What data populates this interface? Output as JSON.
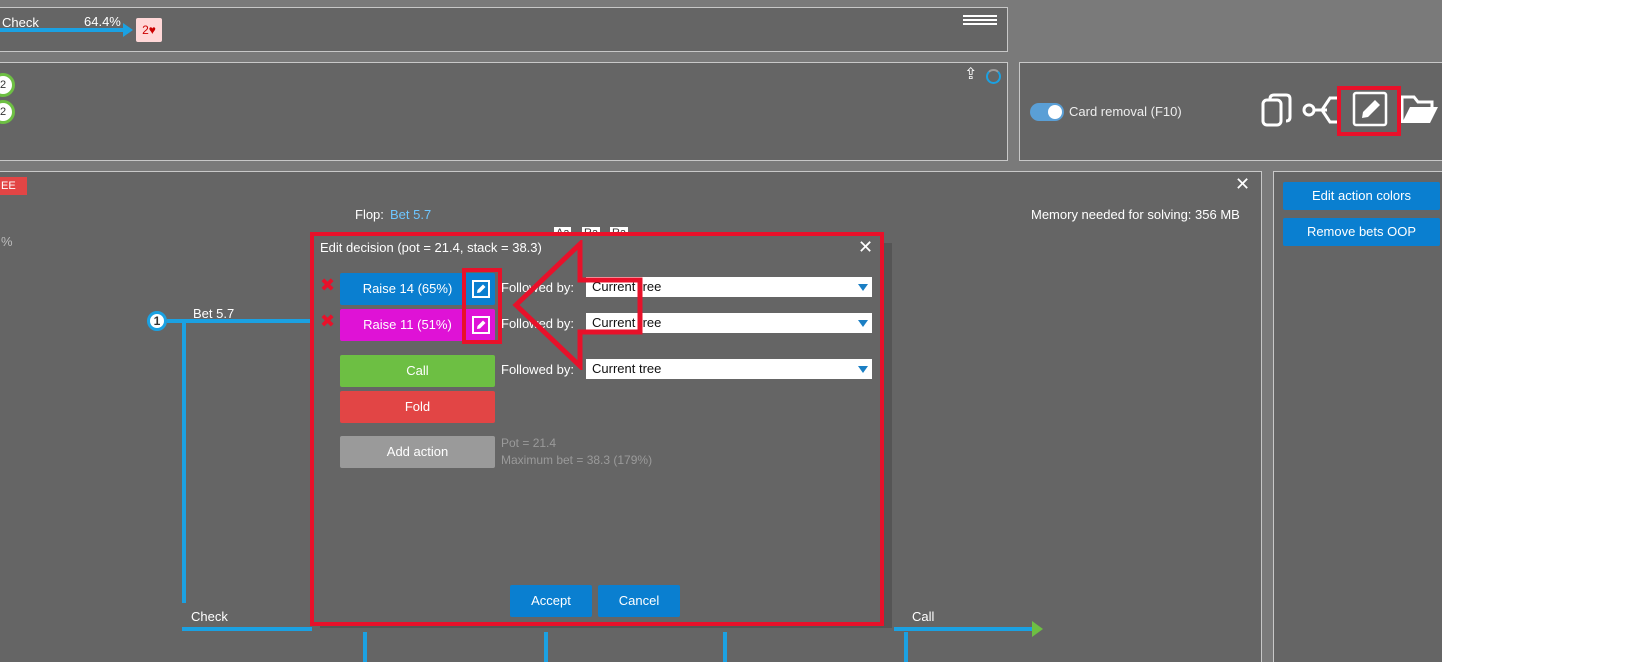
{
  "top_bar": {
    "check_label": "Check",
    "percent": "64.4%",
    "card": "2♥"
  },
  "range_panel": {
    "badge_a": "2",
    "badge_b": "2"
  },
  "options": {
    "card_removal_label": "Card removal (F10)"
  },
  "tree": {
    "tag": "EE",
    "side_percent": "%",
    "flop_label": "Flop:",
    "flop_value": "Bet 5.7",
    "memory": "Memory needed for solving: 356 MB",
    "node_1": "1",
    "bet_label": "Bet 5.7",
    "check_label": "Check",
    "call_label": "Call",
    "mini_labels": [
      "Aa",
      "Ra",
      "Ra"
    ]
  },
  "right_buttons": {
    "edit_colors": "Edit action colors",
    "remove_bets": "Remove bets OOP"
  },
  "dialog": {
    "title": "Edit decision (pot = 21.4, stack = 38.3)",
    "actions": [
      {
        "label": "Raise 14 (65%)",
        "followed_by": "Followed by:",
        "select": "Current tree",
        "color": "#0a7fd0"
      },
      {
        "label": "Raise 11 (51%)",
        "followed_by": "Followed by:",
        "select": "Current tree",
        "color": "#df12d6"
      }
    ],
    "call": {
      "label": "Call",
      "followed_by": "Followed by:",
      "select": "Current tree",
      "color": "#6dbf43"
    },
    "fold": {
      "label": "Fold",
      "color": "#e24545"
    },
    "add_action": "Add action",
    "pot_info": "Pot = 21.4",
    "max_bet": "Maximum bet = 38.3 (179%)",
    "accept": "Accept",
    "cancel": "Cancel"
  }
}
